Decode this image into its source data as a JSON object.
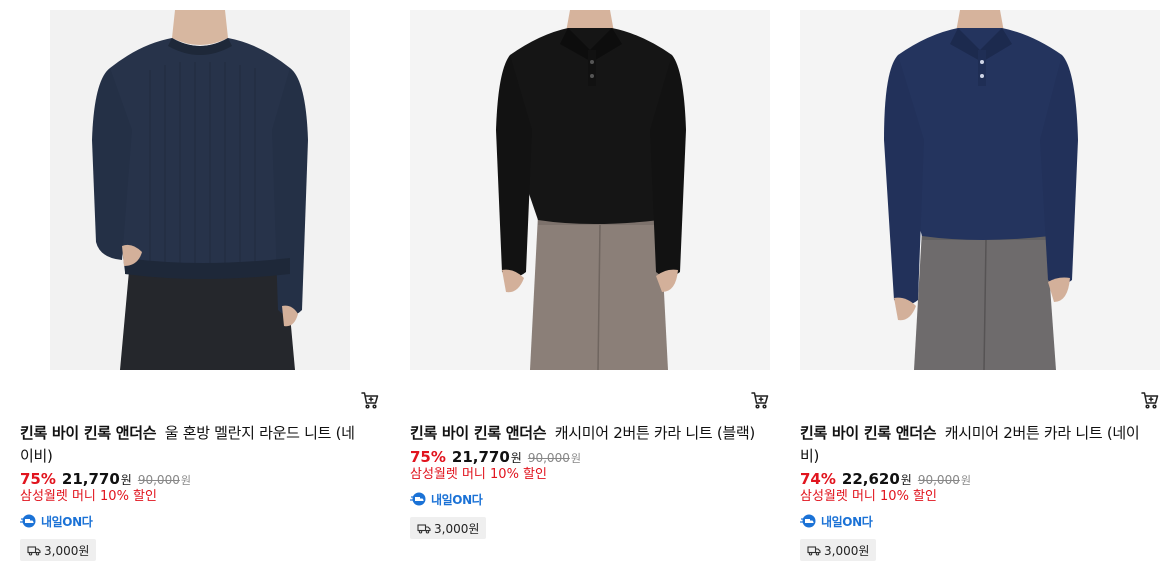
{
  "products": [
    {
      "brand": "킨록 바이 킨록 앤더슨",
      "name": "울 혼방 멜란지 라운드 니트 (네이비)",
      "discount_rate": "75%",
      "price": "21,770",
      "price_unit": "원",
      "original_price": "90,000",
      "original_unit": "원",
      "promo": "삼성월렛 머니 10% 할인",
      "delivery_badge": "내일ON다",
      "shipping_fee": "3,000원",
      "image_alt": "navy round neck knit sweater"
    },
    {
      "brand": "킨록 바이 킨록 앤더슨",
      "name": "캐시미어 2버튼 카라 니트 (블랙)",
      "discount_rate": "75%",
      "price": "21,770",
      "price_unit": "원",
      "original_price": "90,000",
      "original_unit": "원",
      "promo": "삼성월렛 머니 10% 할인",
      "delivery_badge": "내일ON다",
      "shipping_fee": "3,000원",
      "image_alt": "black two-button collar knit"
    },
    {
      "brand": "킨록 바이 킨록 앤더슨",
      "name": "캐시미어 2버튼 카라 니트 (네이비)",
      "discount_rate": "74%",
      "price": "22,620",
      "price_unit": "원",
      "original_price": "90,000",
      "original_unit": "원",
      "promo": "삼성월렛 머니 10% 할인",
      "delivery_badge": "내일ON다",
      "shipping_fee": "3,000원",
      "image_alt": "navy two-button collar knit"
    }
  ],
  "colors": {
    "discount": "#e1141e",
    "badge": "#1b72d6",
    "shipping_bg": "#efefef",
    "navy_knit": "#27334a",
    "black_knit": "#151515",
    "navy_polo": "#24345e",
    "trousers_brown": "#8b7f78",
    "trousers_gray": "#6e6b6c"
  },
  "icons": {
    "cart": "cart-icon",
    "delivery_badge": "truck-fast-icon",
    "shipping": "truck-icon"
  }
}
